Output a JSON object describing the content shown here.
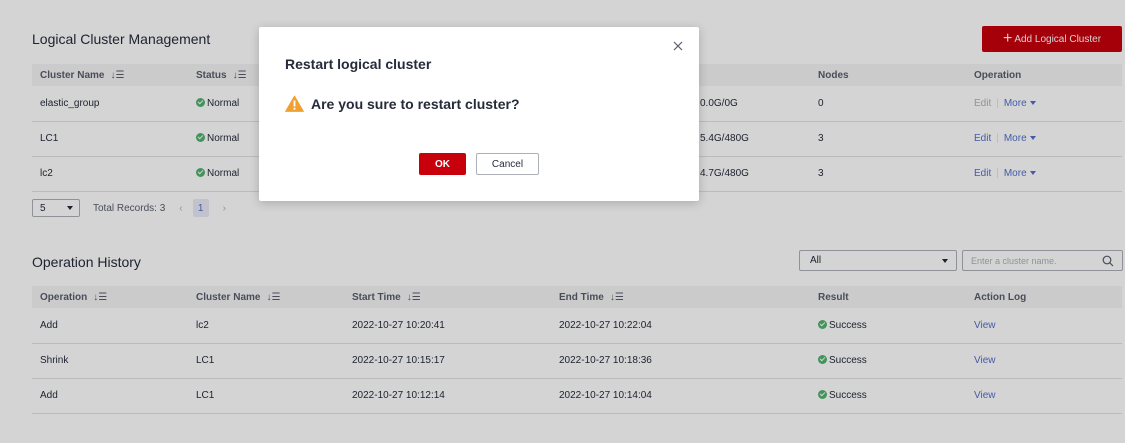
{
  "cluster_section": {
    "title": "Logical Cluster Management",
    "add_button_label": "Add Logical Cluster",
    "columns": [
      "Cluster Name",
      "Status",
      "",
      "Nodes",
      "Operation"
    ],
    "rows": [
      {
        "name": "elastic_group",
        "status": "Normal",
        "storage": "0.0G/0G",
        "nodes": "0",
        "edit": "Edit",
        "more": "More"
      },
      {
        "name": "LC1",
        "status": "Normal",
        "storage": "5.4G/480G",
        "nodes": "3",
        "edit": "Edit",
        "more": "More"
      },
      {
        "name": "lc2",
        "status": "Normal",
        "storage": "4.7G/480G",
        "nodes": "3",
        "edit": "Edit",
        "more": "More"
      }
    ],
    "pagination": {
      "page_size": "5",
      "total": "Total Records: 3",
      "current_page": "1",
      "prev": "‹",
      "next": "›"
    }
  },
  "history_section": {
    "title": "Operation History",
    "filter_value": "All",
    "search_placeholder": "Enter a cluster name.",
    "columns": [
      "Operation",
      "Cluster Name",
      "Start Time",
      "End Time",
      "Result",
      "Action Log"
    ],
    "rows": [
      {
        "operation": "Add",
        "cluster": "lc2",
        "start": "2022-10-27 10:20:41",
        "end": "2022-10-27 10:22:04",
        "result": "Success",
        "log": "View"
      },
      {
        "operation": "Shrink",
        "cluster": "LC1",
        "start": "2022-10-27 10:15:17",
        "end": "2022-10-27 10:18:36",
        "result": "Success",
        "log": "View"
      },
      {
        "operation": "Add",
        "cluster": "LC1",
        "start": "2022-10-27 10:12:14",
        "end": "2022-10-27 10:14:04",
        "result": "Success",
        "log": "View"
      }
    ]
  },
  "dialog": {
    "title": "Restart logical cluster",
    "message": "Are you sure to restart cluster?",
    "ok_label": "OK",
    "cancel_label": "Cancel"
  },
  "icons": {
    "sort": "sort-icon",
    "status_ok": "check-circle-icon",
    "warning": "warning-triangle-icon",
    "close": "close-icon",
    "search": "search-icon"
  },
  "colors": {
    "accent": "#c7000b",
    "link": "#526ecc",
    "success": "#50b370",
    "warning": "#f0a030"
  }
}
